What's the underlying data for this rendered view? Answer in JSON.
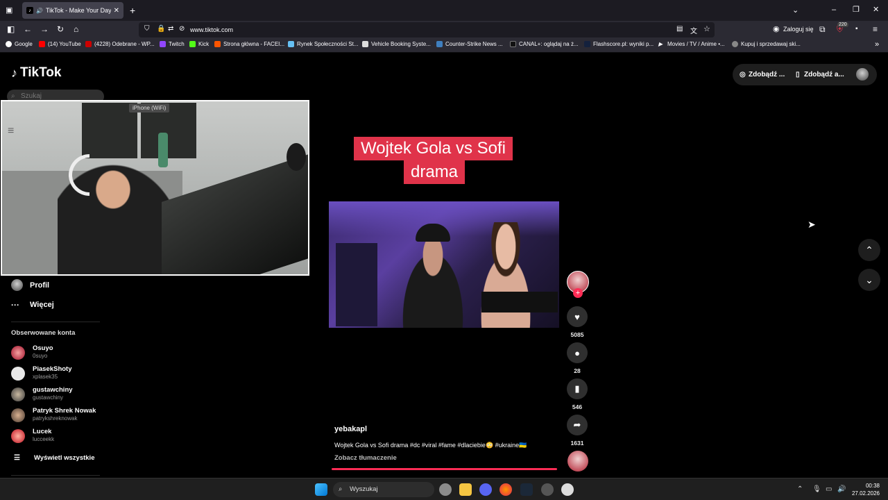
{
  "browser": {
    "tab_title": "TikTok - Make Your Day",
    "url": "www.tiktok.com",
    "login_label": "Zaloguj się",
    "badge_count": "220",
    "bookmarks": [
      "Google",
      "(14) YouTube",
      "(4228) Odebrane - WP...",
      "Twitch",
      "Kick",
      "Strona główna - FACEI...",
      "Rynek Społeczności St...",
      "Vehicle Booking Syste...",
      "Counter-Strike News ...",
      "CANAL+: oglądaj na ż...",
      "Flashscore.pl: wyniki p...",
      "Movies / TV / Anime •...",
      "Kupuj i sprzedawaj ski..."
    ]
  },
  "tiktok": {
    "logo": "TikTok",
    "search_placeholder": "Szukaj",
    "top_buttons": [
      "Zdobądź ...",
      "Zdobądź a..."
    ],
    "cam_label": "iPhone (WiFi)",
    "nav": {
      "profile": "Profil",
      "more": "Więcej"
    },
    "following_title": "Obserwowane konta",
    "following": [
      {
        "name": "Osuyo",
        "handle": "0suyo"
      },
      {
        "name": "PiasekShoty",
        "handle": "xplasek35"
      },
      {
        "name": "gustawchiny",
        "handle": "gustawchiny"
      },
      {
        "name": "Patryk Shrek Nowak",
        "handle": "patrykshreknowak"
      },
      {
        "name": "Lucek",
        "handle": "lucceekk"
      }
    ],
    "see_all": "Wyświetl wszystkie",
    "video": {
      "title_line1": "Wojtek Gola vs Sofi",
      "title_line2": "drama",
      "author": "yebakapl",
      "description": "Wojtek Gola vs Sofi drama #dc #viral #fame #dlaciebie😳 #ukraine🇺🇦",
      "translate": "Zobacz tłumaczenie",
      "likes": "5085",
      "comments": "28",
      "saves": "546",
      "shares": "1631"
    }
  },
  "taskbar": {
    "search": "Wyszukaj",
    "time": "00:38",
    "date": "27.02.2026"
  }
}
